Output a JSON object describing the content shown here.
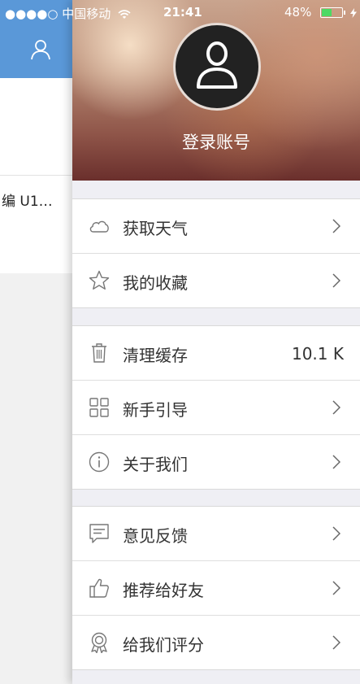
{
  "status_bar": {
    "carrier": "●●●●○ 中国移动",
    "wifi_icon": "wifi-icon",
    "time": "21:41",
    "battery_text": "48%",
    "battery_level": 0.48,
    "battery_color": "#4cd964",
    "charging_icon": "bolt-icon"
  },
  "main_page": {
    "header_color": "#5a98d8",
    "user_icon": "user-icon",
    "list_snippet": "编 U1…"
  },
  "drawer": {
    "avatar_icon": "user-icon",
    "login_label": "登录账号",
    "groups": [
      {
        "items": [
          {
            "icon": "cloud-icon",
            "label": "获取天气"
          },
          {
            "icon": "star-icon",
            "label": "我的收藏"
          }
        ]
      },
      {
        "items": [
          {
            "icon": "trash-icon",
            "label": "清理缓存",
            "value": "10.1 K"
          },
          {
            "icon": "grid-icon",
            "label": "新手引导"
          },
          {
            "icon": "info-icon",
            "label": "关于我们"
          }
        ]
      },
      {
        "items": [
          {
            "icon": "feedback-icon",
            "label": "意见反馈"
          },
          {
            "icon": "thumbs-up-icon",
            "label": "推荐给好友"
          },
          {
            "icon": "award-icon",
            "label": "给我们评分"
          }
        ]
      }
    ]
  }
}
